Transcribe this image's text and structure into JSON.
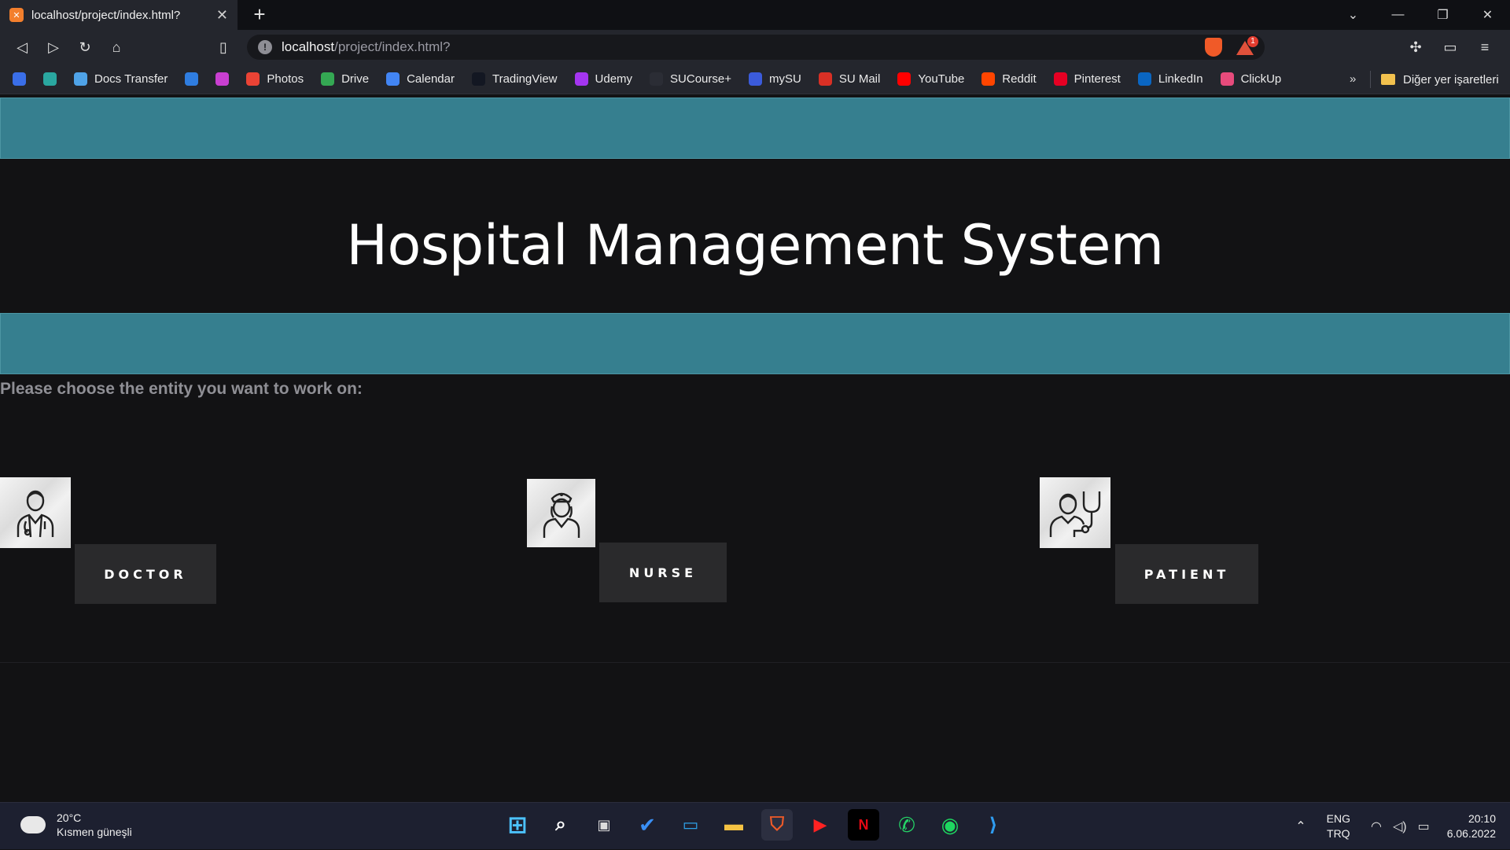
{
  "browser": {
    "tab_title": "localhost/project/index.html?",
    "url_host": "localhost",
    "url_path": "/project/index.html?",
    "rewards_badge": "1",
    "bookmarks": [
      {
        "label": "",
        "color": "#3a6ee8",
        "icon": "graduation-icon"
      },
      {
        "label": "",
        "color": "#2aa7a0",
        "icon": "ai-icon"
      },
      {
        "label": "Docs Transfer",
        "color": "#4fa3e8",
        "icon": "wifi-icon"
      },
      {
        "label": "",
        "color": "#2f7de0",
        "icon": "bars-icon"
      },
      {
        "label": "",
        "color": "#c93fd1",
        "icon": "t-icon"
      },
      {
        "label": "Photos",
        "color": "#ea4335",
        "icon": "pinwheel-icon"
      },
      {
        "label": "Drive",
        "color": "#34a853",
        "icon": "drive-icon"
      },
      {
        "label": "Calendar",
        "color": "#4285f4",
        "icon": "calendar-icon"
      },
      {
        "label": "TradingView",
        "color": "#131722",
        "icon": "tradingview-icon"
      },
      {
        "label": "Udemy",
        "color": "#a435f0",
        "icon": "udemy-icon"
      },
      {
        "label": "SUCourse+",
        "color": "#2b2d35",
        "icon": "moodle-icon"
      },
      {
        "label": "mySU",
        "color": "#3b5bdb",
        "icon": "mysu-icon"
      },
      {
        "label": "SU Mail",
        "color": "#d93025",
        "icon": "gmail-icon"
      },
      {
        "label": "YouTube",
        "color": "#ff0000",
        "icon": "youtube-icon"
      },
      {
        "label": "Reddit",
        "color": "#ff4500",
        "icon": "reddit-icon"
      },
      {
        "label": "Pinterest",
        "color": "#e60023",
        "icon": "pinterest-icon"
      },
      {
        "label": "LinkedIn",
        "color": "#0a66c2",
        "icon": "linkedin-icon"
      },
      {
        "label": "ClickUp",
        "color": "#e74b7c",
        "icon": "clickup-icon"
      }
    ],
    "bookmarks_more": "»",
    "other_bookmarks": "Diğer yer işaretleri"
  },
  "page": {
    "title": "Hospital Management System",
    "prompt": "Please choose the entity you want to work on:",
    "entities": [
      {
        "label": "DOCTOR",
        "icon": "doctor-icon"
      },
      {
        "label": "NURSE",
        "icon": "nurse-icon"
      },
      {
        "label": "PATIENT",
        "icon": "patient-icon"
      }
    ],
    "colors": {
      "band": "#367f8f",
      "background": "#121214",
      "button": "#2a2a2c"
    }
  },
  "taskbar": {
    "weather_temp": "20°C",
    "weather_desc": "Kısmen güneşli",
    "lang_top": "ENG",
    "lang_bottom": "TRQ",
    "time": "20:10",
    "date": "6.06.2022"
  }
}
